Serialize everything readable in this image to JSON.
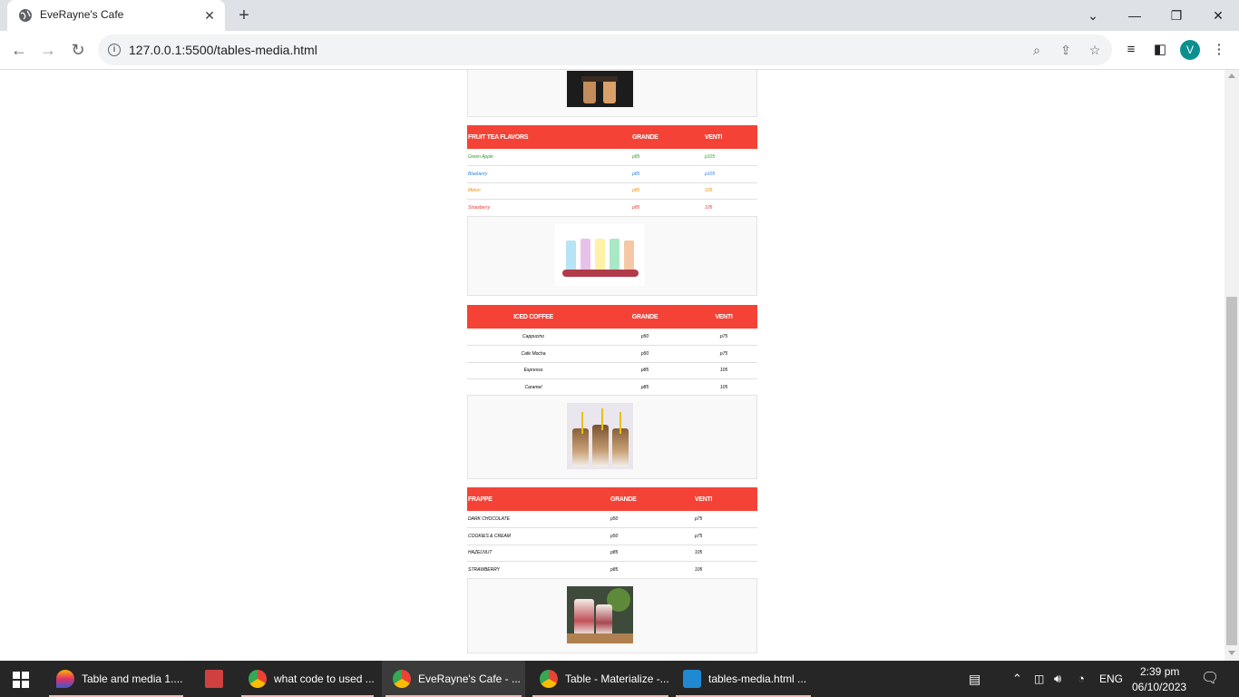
{
  "browser": {
    "tab_title": "EveRayne's Cafe",
    "url": "127.0.0.1:5500/tables-media.html",
    "profile_initial": "V"
  },
  "tables": {
    "fruit_tea": {
      "headers": [
        "FRUIT TEA FLAVORS",
        "GRANDE",
        "VENTI"
      ],
      "rows": [
        {
          "name": "Green Apple",
          "grande": "p85",
          "venti": "p105",
          "color": "#2e9b2e"
        },
        {
          "name": "Blueberry",
          "grande": "p85",
          "venti": "p105",
          "color": "#2d7de0"
        },
        {
          "name": "Melon",
          "grande": "p85",
          "venti": "105",
          "color": "#f08c00"
        },
        {
          "name": "Strawberry",
          "grande": "p85",
          "venti": "105",
          "color": "#e53935"
        }
      ]
    },
    "iced_coffee": {
      "headers": [
        "ICED COFFEE",
        "GRANDE",
        "VENTI"
      ],
      "rows": [
        {
          "name": "Cappucino",
          "grande": "p50",
          "venti": "p75"
        },
        {
          "name": "Cafe Mocha",
          "grande": "p50",
          "venti": "p75"
        },
        {
          "name": "Espresso",
          "grande": "p85",
          "venti": "105"
        },
        {
          "name": "Caramel",
          "grande": "p85",
          "venti": "105"
        }
      ]
    },
    "frappe": {
      "headers": [
        "FRAPPE",
        "GRANDE",
        "VENTI"
      ],
      "rows": [
        {
          "name": "DARK CHOCOLATE",
          "grande": "p50",
          "venti": "p75"
        },
        {
          "name": "COOKIES & CREAM",
          "grande": "p50",
          "venti": "p75"
        },
        {
          "name": "HAZELNUT",
          "grande": "p85",
          "venti": "105"
        },
        {
          "name": "STRAWBERRY",
          "grande": "p85",
          "venti": "105"
        }
      ]
    }
  },
  "taskbar": {
    "apps": [
      {
        "label": "Table and media 1...."
      },
      {
        "label": ""
      },
      {
        "label": "what code to used ..."
      },
      {
        "label": "EveRayne's Cafe - ..."
      },
      {
        "label": "Table - Materialize -..."
      },
      {
        "label": "tables-media.html ..."
      }
    ],
    "language": "ENG",
    "time": "2:39 pm",
    "date": "06/10/2023"
  },
  "colors": {
    "header_red": "#f44336",
    "tab_strip": "#dee1e6",
    "taskbar": "#262626"
  }
}
